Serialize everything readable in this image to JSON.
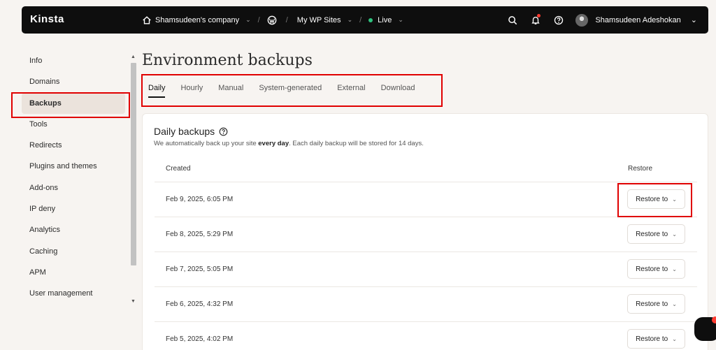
{
  "topbar": {
    "logo": "Kinsta",
    "breadcrumbs": [
      {
        "label": "Shamsudeen's company",
        "icon": "home-icon"
      },
      {
        "label": "My WP Sites",
        "icon": "wordpress-icon"
      },
      {
        "label": "Live",
        "icon": "status-dot",
        "status_color": "#2ec27e"
      }
    ],
    "user_name": "Shamsudeen Adeshokan"
  },
  "sidebar": {
    "items": [
      {
        "label": "Info"
      },
      {
        "label": "Domains"
      },
      {
        "label": "Backups",
        "active": true
      },
      {
        "label": "Tools"
      },
      {
        "label": "Redirects"
      },
      {
        "label": "Plugins and themes"
      },
      {
        "label": "Add-ons"
      },
      {
        "label": "IP deny"
      },
      {
        "label": "Analytics"
      },
      {
        "label": "Caching"
      },
      {
        "label": "APM"
      },
      {
        "label": "User management"
      }
    ]
  },
  "main": {
    "title": "Environment backups",
    "tabs": [
      {
        "label": "Daily",
        "active": true
      },
      {
        "label": "Hourly"
      },
      {
        "label": "Manual"
      },
      {
        "label": "System-generated"
      },
      {
        "label": "External"
      },
      {
        "label": "Download"
      }
    ],
    "card": {
      "title": "Daily backups",
      "desc_prefix": "We automatically back up your site ",
      "desc_bold": "every day",
      "desc_suffix": ". Each daily backup will be stored for 14 days.",
      "col_created": "Created",
      "col_restore": "Restore",
      "restore_label": "Restore to",
      "rows": [
        {
          "created": "Feb 9, 2025, 6:05 PM"
        },
        {
          "created": "Feb 8, 2025, 5:29 PM"
        },
        {
          "created": "Feb 7, 2025, 5:05 PM"
        },
        {
          "created": "Feb 6, 2025, 4:32 PM"
        },
        {
          "created": "Feb 5, 2025, 4:02 PM"
        }
      ]
    }
  },
  "colors": {
    "accent_highlight": "#e00000",
    "topbar_bg": "#0e0e0e",
    "active_sidebar_bg": "#ebe3dc"
  }
}
